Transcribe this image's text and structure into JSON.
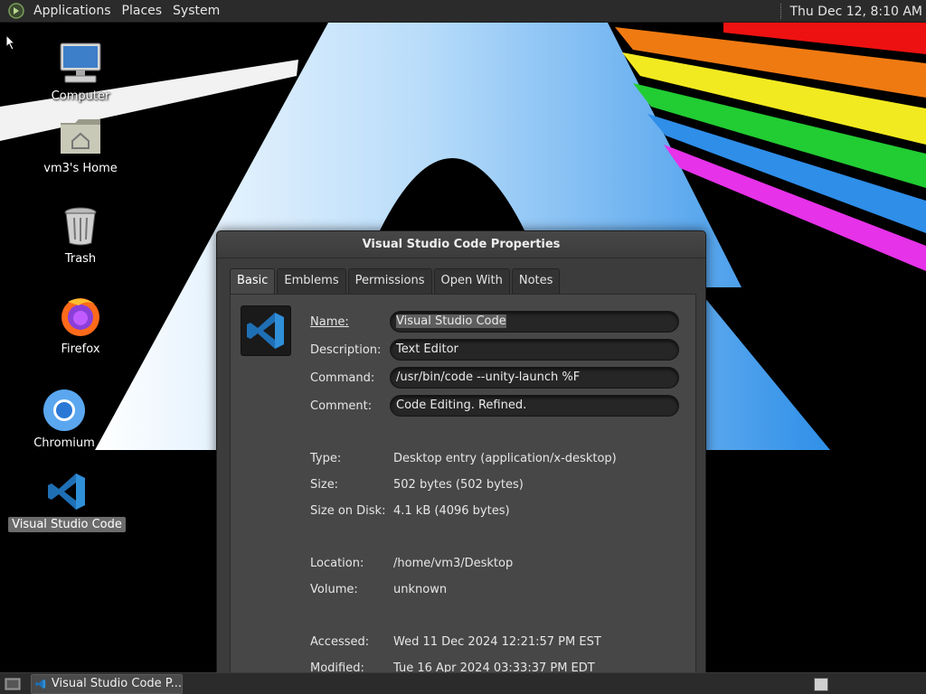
{
  "top_panel": {
    "menus": [
      "Applications",
      "Places",
      "System"
    ],
    "clock": "Thu Dec 12,  8:10 AM"
  },
  "desktop_icons": [
    {
      "label": "Computer",
      "icon": "computer-icon"
    },
    {
      "label": "vm3's Home",
      "icon": "home-folder-icon"
    },
    {
      "label": "Trash",
      "icon": "trash-icon"
    },
    {
      "label": "Firefox",
      "icon": "firefox-icon"
    },
    {
      "label": "Chromium",
      "icon": "chromium-icon"
    },
    {
      "label": "Visual Studio Code",
      "icon": "vscode-icon",
      "selected": true
    }
  ],
  "dialog": {
    "title": "Visual Studio Code Properties",
    "tabs": [
      "Basic",
      "Emblems",
      "Permissions",
      "Open With",
      "Notes"
    ],
    "active_tab": "Basic",
    "fields": {
      "name": {
        "label": "Name:",
        "value": "Visual Studio Code"
      },
      "description": {
        "label": "Description:",
        "value": "Text Editor"
      },
      "command": {
        "label": "Command:",
        "value": "/usr/bin/code --unity-launch %F"
      },
      "comment": {
        "label": "Comment:",
        "value": "Code Editing. Refined."
      }
    },
    "info": {
      "type": {
        "label": "Type:",
        "value": "Desktop entry (application/x-desktop)"
      },
      "size": {
        "label": "Size:",
        "value": "502 bytes (502 bytes)"
      },
      "size_on_disk": {
        "label": "Size on Disk:",
        "value": "4.1 kB (4096 bytes)"
      },
      "location": {
        "label": "Location:",
        "value": "/home/vm3/Desktop"
      },
      "volume": {
        "label": "Volume:",
        "value": "unknown"
      },
      "accessed": {
        "label": "Accessed:",
        "value": "Wed 11 Dec 2024 12:21:57 PM EST"
      },
      "modified": {
        "label": "Modified:",
        "value": "Tue 16 Apr 2024 03:33:37 PM EDT"
      }
    }
  },
  "taskbar": {
    "task_label": "Visual Studio Code P..."
  },
  "colors": {
    "panel": "#2b2b2b",
    "dialog": "#3c3c3c",
    "vscode_blue": "#2f8fd8",
    "wallpaper_blue": "#3aa0f0"
  }
}
